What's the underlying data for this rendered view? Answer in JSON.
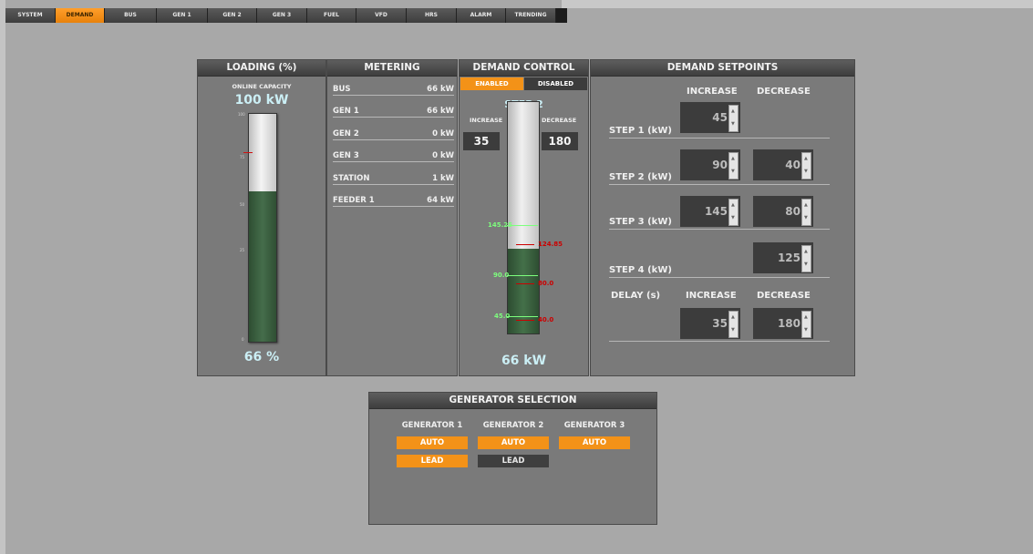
{
  "tabs": [
    "SYSTEM",
    "DEMAND",
    "BUS",
    "GEN 1",
    "GEN 2",
    "GEN 3",
    "FUEL",
    "VFD",
    "HRS",
    "ALARM",
    "TRENDING"
  ],
  "active_tab": "DEMAND",
  "loading": {
    "title": "LOADING (%)",
    "capacity_label": "ONLINE CAPACITY",
    "capacity_value": "100 kW",
    "percent_text": "66 %",
    "level_fraction": 0.66,
    "scale_ticks": [
      "100",
      "75",
      "50",
      "25",
      "0"
    ],
    "marker_value": 83
  },
  "metering": {
    "title": "METERING",
    "rows": [
      {
        "label": "BUS",
        "value": "66 kW"
      },
      {
        "label": "GEN 1",
        "value": "66 kW"
      },
      {
        "label": "GEN 2",
        "value": "0 kW"
      },
      {
        "label": "GEN 3",
        "value": "0 kW"
      },
      {
        "label": "STATION",
        "value": "1 kW"
      },
      {
        "label": "FEEDER 1",
        "value": "64 kW"
      }
    ]
  },
  "demand_control": {
    "title": "DEMAND CONTROL",
    "enabled_label": "ENABLED",
    "disabled_label": "DISABLED",
    "step_label": "STEP 2",
    "increase_label": "INCREASE",
    "decrease_label": "DECREASE",
    "increase_value": "35",
    "decrease_value": "180",
    "load_text": "66 kW",
    "load_kw": 66,
    "scale_max_kw": 180,
    "markers_green": [
      "145.25",
      "90.0",
      "45.0"
    ],
    "markers_red": [
      "124.85",
      "80.0",
      "40.0"
    ]
  },
  "setpoints": {
    "title": "DEMAND SETPOINTS",
    "increase_header": "INCREASE",
    "decrease_header": "DECREASE",
    "steps": [
      {
        "label": "STEP 1 (kW)",
        "increase": "45",
        "decrease": ""
      },
      {
        "label": "STEP 2 (kW)",
        "increase": "90",
        "decrease": "40"
      },
      {
        "label": "STEP 3 (kW)",
        "increase": "145",
        "decrease": "80"
      },
      {
        "label": "STEP 4 (kW)",
        "increase": "",
        "decrease": "125"
      }
    ],
    "delay_label": "DELAY (s)",
    "delay_increase": "35",
    "delay_decrease": "180"
  },
  "generator_selection": {
    "title": "GENERATOR SELECTION",
    "generators": [
      {
        "name": "GENERATOR 1",
        "mode": "AUTO",
        "lead": "LEAD",
        "lead_active": true
      },
      {
        "name": "GENERATOR 2",
        "mode": "AUTO",
        "lead": "LEAD",
        "lead_active": false
      },
      {
        "name": "GENERATOR 3",
        "mode": "AUTO",
        "lead": "",
        "lead_active": false
      }
    ]
  },
  "colors": {
    "accent": "#f39218",
    "panel": "#7a7a7a",
    "fill_green": "#456d4b"
  }
}
